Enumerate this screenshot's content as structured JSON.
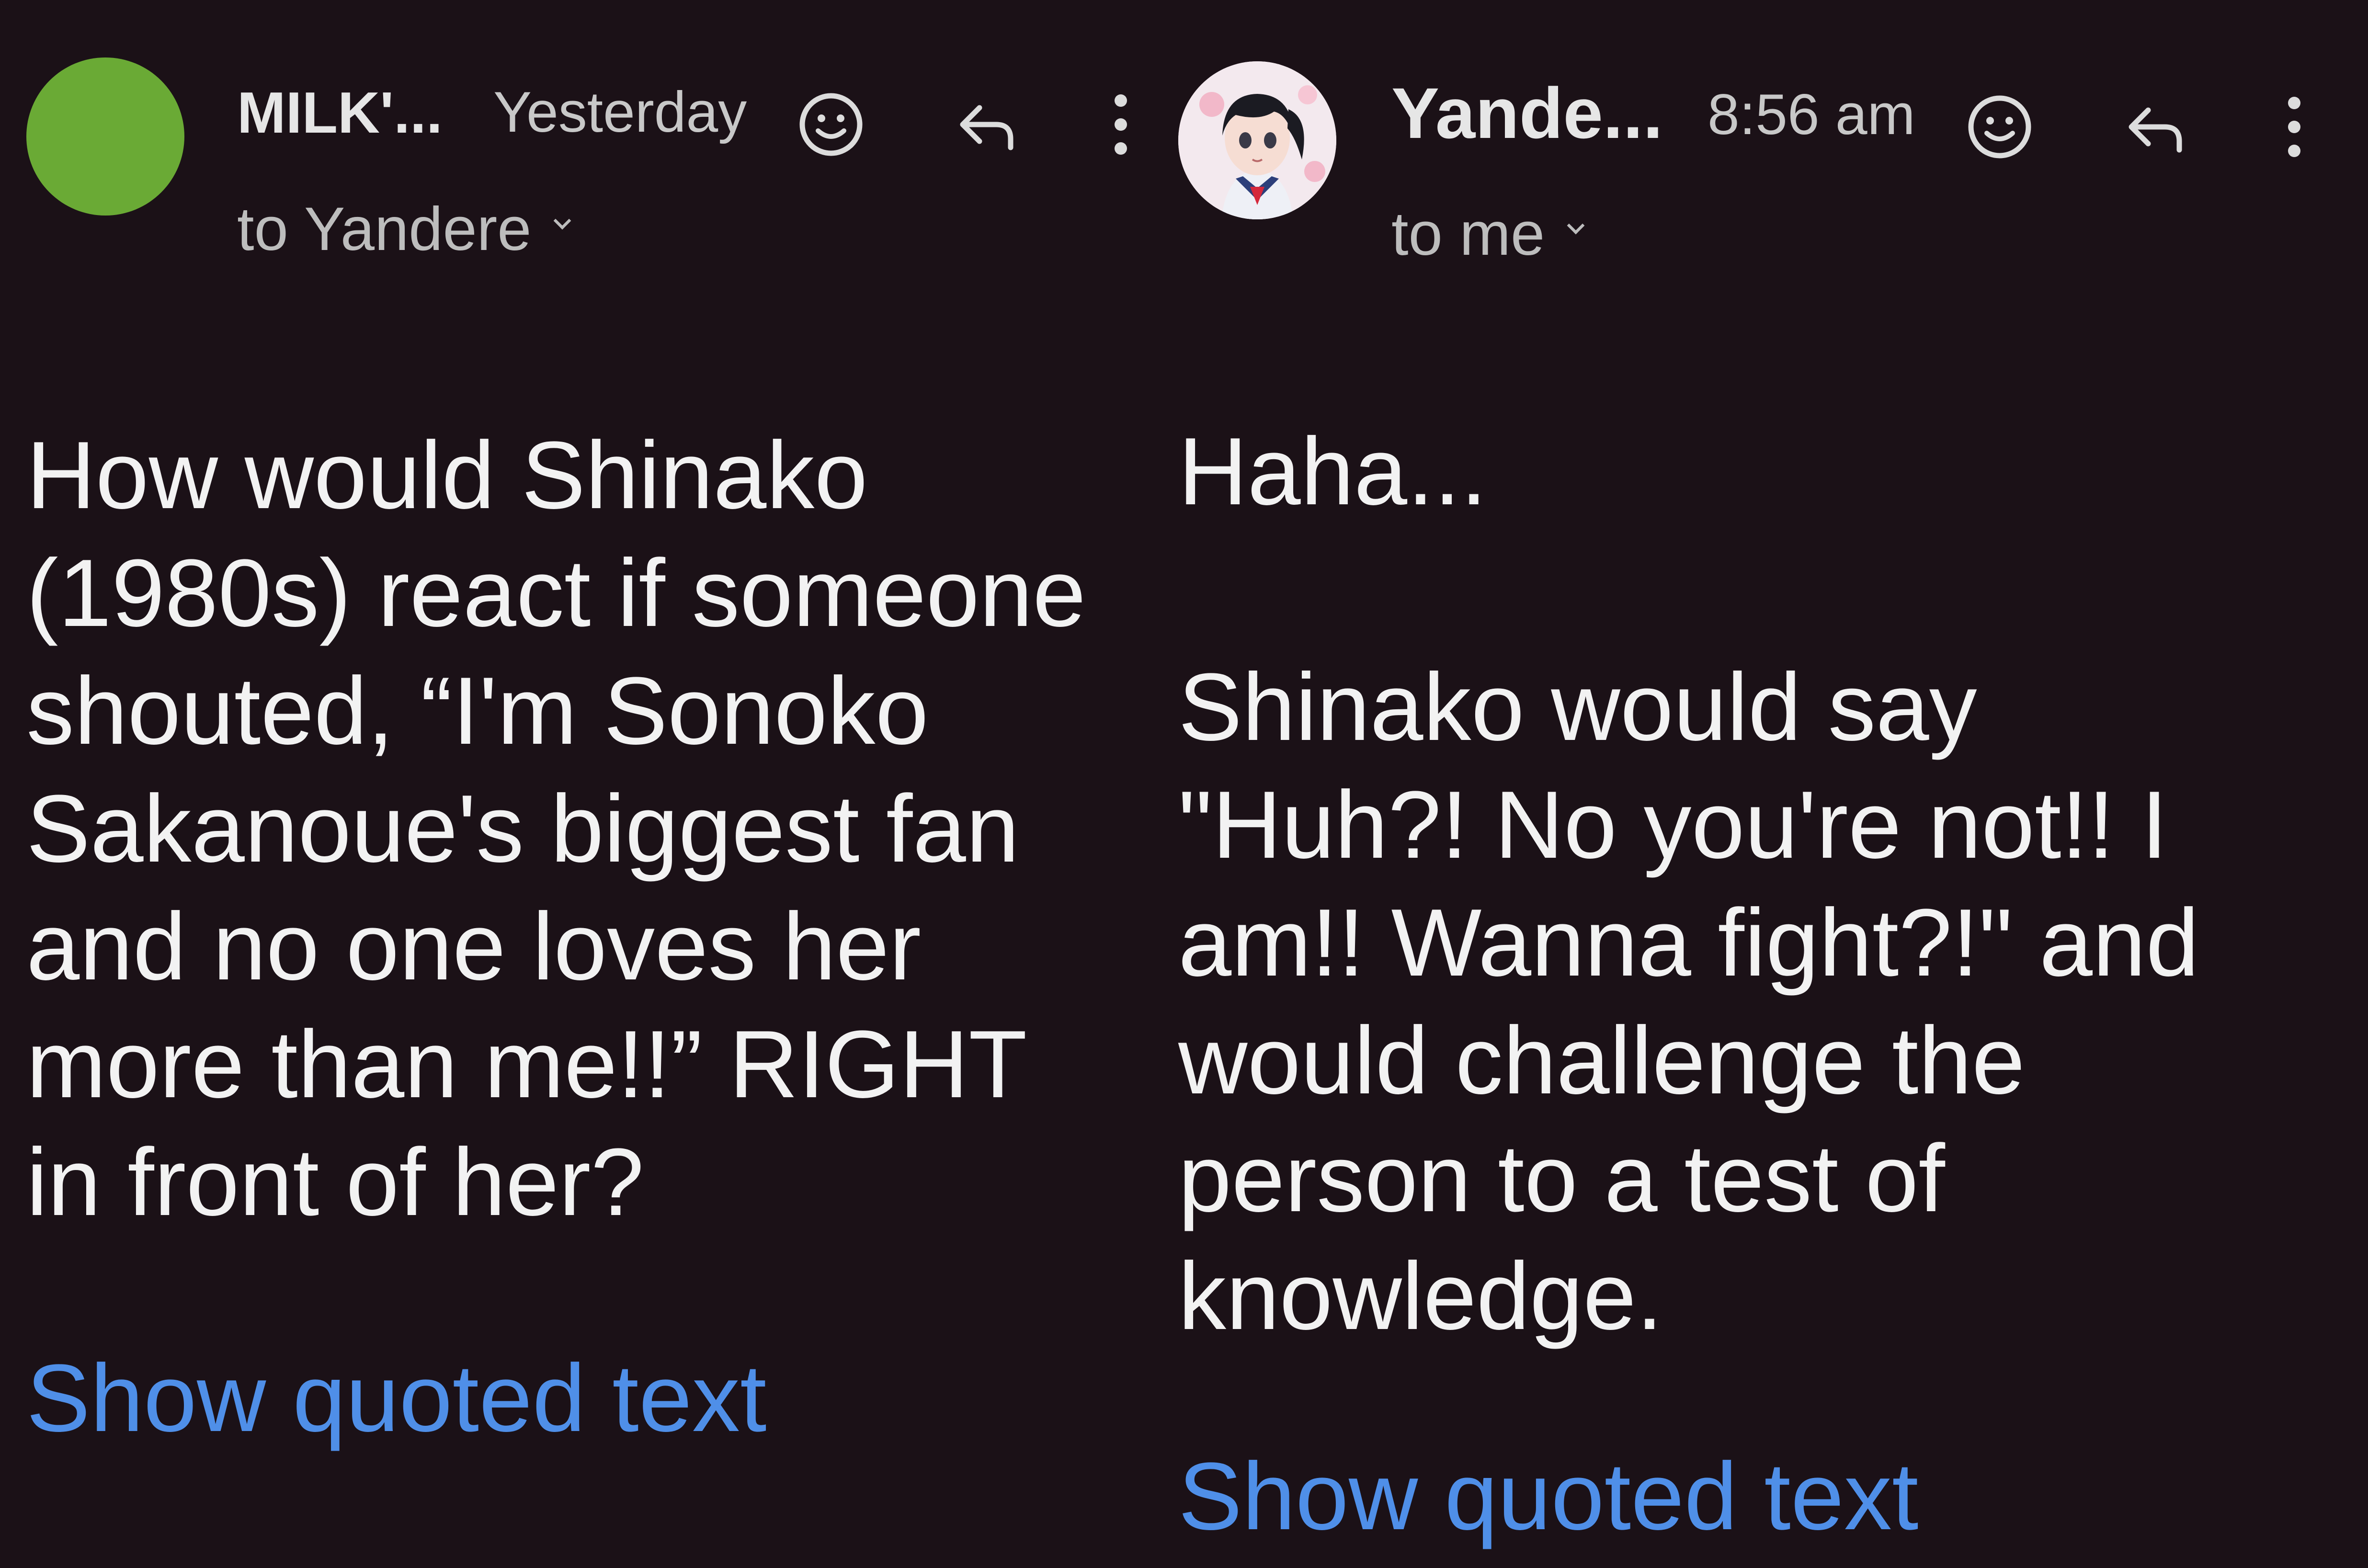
{
  "colors": {
    "background": "#1b1117",
    "avatar_left": "#6aaa35",
    "link": "#4f8fe8",
    "text": "#f2f2f2"
  },
  "emails": [
    {
      "sender": "MILK'...",
      "timestamp": "Yesterday",
      "recipient": "to Yandere",
      "avatar": "green-circle",
      "icons": [
        "emoji-reaction-icon",
        "reply-icon",
        "more-vert-icon"
      ],
      "body_lines": [
        "How would Shinako",
        "(1980s) react if someone",
        "shouted, “I'm Sonoko",
        "Sakanoue's biggest fan",
        "and no one loves her",
        "more than me!!” RIGHT",
        "in front of her?"
      ],
      "quoted_link": "Show quoted text"
    },
    {
      "sender": "Yande...",
      "timestamp": "8:56 am",
      "recipient": "to me",
      "avatar": "anime-girl-profile-picture",
      "icons": [
        "emoji-reaction-icon",
        "reply-icon",
        "more-vert-icon"
      ],
      "body_lines": [
        "Haha...",
        "",
        "Shinako would say",
        "\"Huh?! No you're not!! I",
        "am!! Wanna fight?!\" and",
        "would challenge the",
        "person to a test of",
        "knowledge."
      ],
      "quoted_link": "Show quoted text"
    }
  ]
}
